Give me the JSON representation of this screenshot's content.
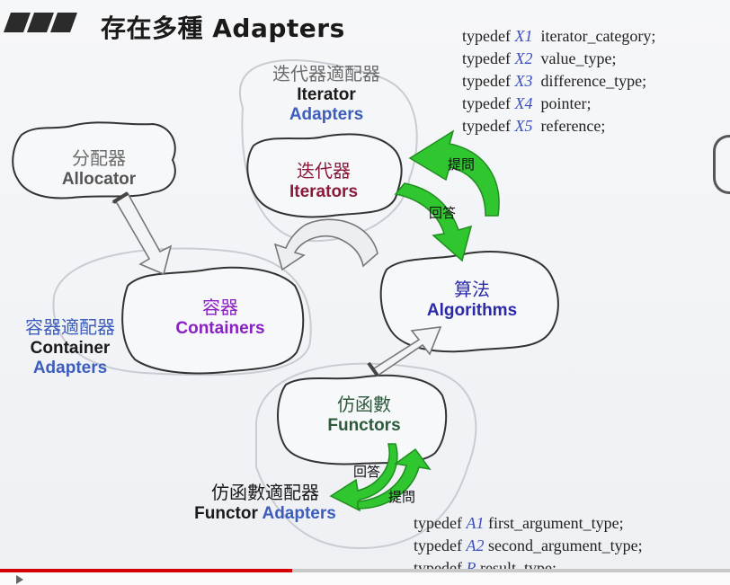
{
  "title": "存在多種 Adapters",
  "allocator": {
    "zh": "分配器",
    "en": "Allocator"
  },
  "iterator_adapters": {
    "zh": "迭代器適配器",
    "en1": "Iterator",
    "en2": "Adapters"
  },
  "iterators": {
    "zh": "迭代器",
    "en": "Iterators"
  },
  "containers": {
    "zh": "容器",
    "en": "Containers"
  },
  "container_adapters": {
    "zh": "容器適配器",
    "en1": "Container",
    "en2": "Adapters"
  },
  "algorithms": {
    "zh": "算法",
    "en": "Algorithms"
  },
  "functors": {
    "zh": "仿函數",
    "en": "Functors"
  },
  "functor_adapters": {
    "zh": "仿函數適配器",
    "en1": "Functor",
    "en2": "Adapters"
  },
  "arrow_labels": {
    "ask_top": "提問",
    "answer_top": "回答",
    "answer_bottom": "回答",
    "ask_bottom": "提問"
  },
  "iterator_typedefs": [
    {
      "kw": "typedef",
      "type": "X1",
      "name": "iterator_category;"
    },
    {
      "kw": "typedef",
      "type": "X2",
      "name": "value_type;"
    },
    {
      "kw": "typedef",
      "type": "X3",
      "name": "difference_type;"
    },
    {
      "kw": "typedef",
      "type": "X4",
      "name": "pointer;"
    },
    {
      "kw": "typedef",
      "type": "X5",
      "name": "reference;"
    }
  ],
  "functor_typedefs": [
    {
      "kw": "typedef",
      "type": "A1",
      "name": "first_argument_type;"
    },
    {
      "kw": "typedef",
      "type": "A2",
      "name": "second_argument_type;"
    },
    {
      "kw": "typedef",
      "type": "R",
      "name": " result_type;"
    }
  ],
  "colors": {
    "zh_gray": "#6b6b6b",
    "blue": "#3c5dbb",
    "dark": "#1a1a1a",
    "iterators_red": "#8b1a3a",
    "containers_purple": "#8a1fc4",
    "algorithms_blue": "#2a2aa8",
    "functors_green": "#2c5a3a",
    "arrow_green": "#2fc62f",
    "progress_red": "#d40000"
  },
  "video_progress": 0.4
}
